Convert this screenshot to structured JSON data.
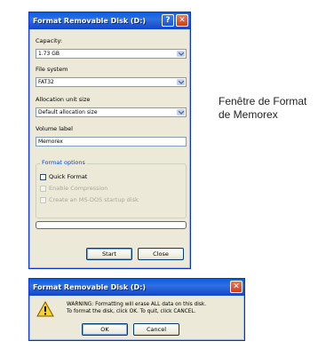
{
  "format_window": {
    "title": "Format Removable Disk (D:)",
    "help_glyph": "?",
    "close_glyph": "✕",
    "capacity": {
      "label": "Capacity:",
      "value": "1.73 GB"
    },
    "file_system": {
      "label": "File system",
      "value": "FAT32"
    },
    "allocation": {
      "label": "Allocation unit size",
      "value": "Default allocation size"
    },
    "volume": {
      "label": "Volume label",
      "value": "Memorex"
    },
    "options": {
      "legend": "Format options",
      "quick_format": "Quick Format",
      "enable_compression": "Enable Compression",
      "msdos_disk": "Create an MS-DOS startup disk"
    },
    "progress": 0,
    "start_label": "Start",
    "close_label": "Close"
  },
  "caption": {
    "line1": "Fenêtre de Format",
    "line2": "de Memorex"
  },
  "warning_dialog": {
    "title": "Format Removable Disk (D:)",
    "close_glyph": "✕",
    "icon": "warning-icon",
    "message_line1": "WARNING: Formatting will erase ALL data on this disk.",
    "message_line2": "To format the disk, click OK. To quit, click CANCEL.",
    "ok_label": "OK",
    "cancel_label": "Cancel"
  },
  "colors": {
    "titlebar": "#2f6fe0",
    "window_bg": "#ece9d8",
    "close_button": "#c8401a",
    "legend_text": "#0046d5"
  }
}
